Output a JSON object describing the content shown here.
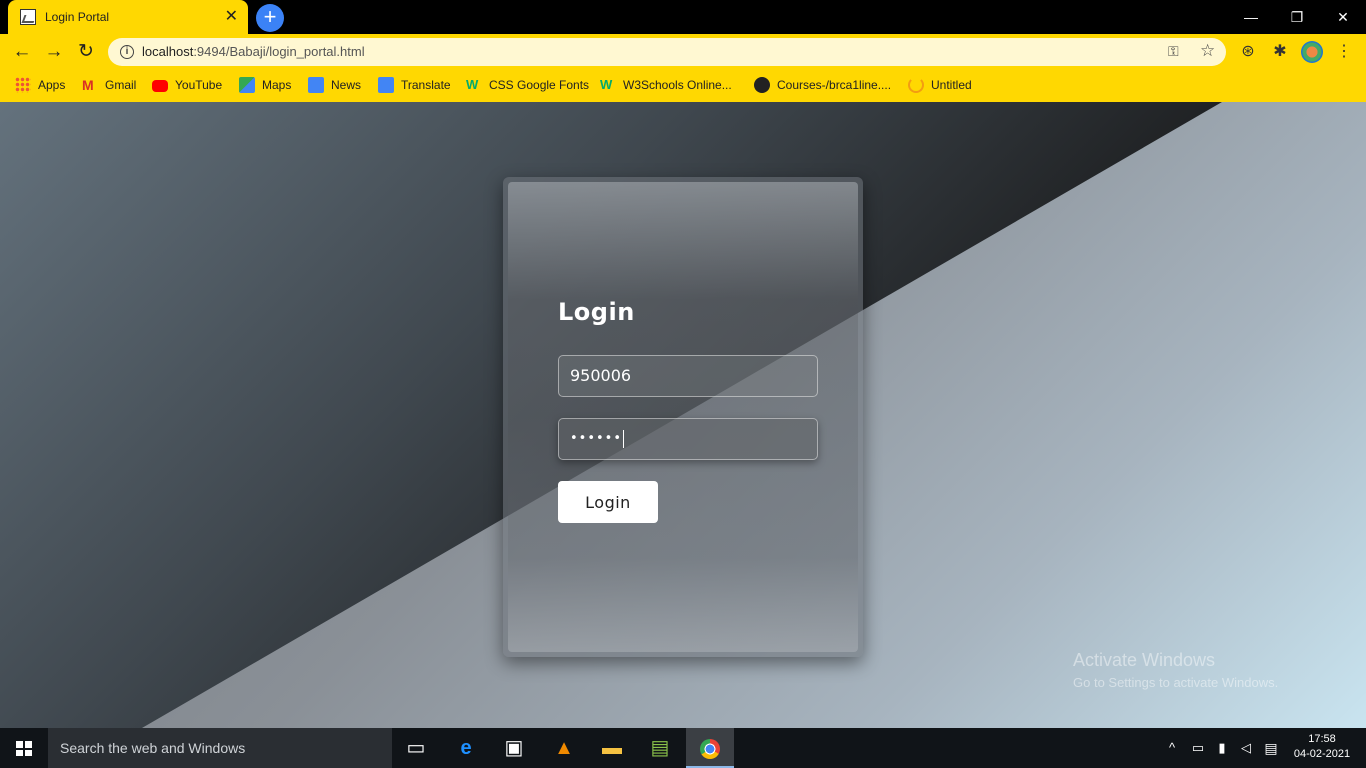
{
  "browser": {
    "tab_title": "Login Portal",
    "tab_close": "✕",
    "new_tab": "+",
    "window_controls": [
      "—",
      "❐",
      "✕"
    ],
    "nav": {
      "back": "←",
      "forward": "→",
      "reload": "↻"
    },
    "address": {
      "host": "localhost",
      "port_path": ":9494/Babaji/login_portal.html"
    },
    "bookmarks": [
      {
        "label": "Apps",
        "icon": "apps-grid-icon"
      },
      {
        "label": "Gmail",
        "icon": "gmail-icon"
      },
      {
        "label": "YouTube",
        "icon": "youtube-icon"
      },
      {
        "label": "Maps",
        "icon": "maps-icon"
      },
      {
        "label": "News",
        "icon": "news-icon"
      },
      {
        "label": "Translate",
        "icon": "translate-icon"
      },
      {
        "label": "CSS Google Fonts",
        "icon": "w3schools-icon"
      },
      {
        "label": "W3Schools Online...",
        "icon": "w3schools-icon"
      },
      {
        "label": "Courses-/brca1line....",
        "icon": "github-icon"
      },
      {
        "label": "Untitled",
        "icon": "loading-icon"
      }
    ]
  },
  "login": {
    "title": "Login",
    "user_id_value": "950006",
    "password_mask": "••••••",
    "button_label": "Login"
  },
  "watermark": {
    "line1": "Activate Windows",
    "line2": "Go to Settings to activate Windows."
  },
  "taskbar": {
    "search_placeholder": "Search the web and Windows",
    "time": "17:58",
    "date": "04-02-2021"
  },
  "colors": {
    "chrome_accent": "#ffd801",
    "omnibox_bg": "#fff8d2",
    "taskbar_bg": "#101418"
  }
}
